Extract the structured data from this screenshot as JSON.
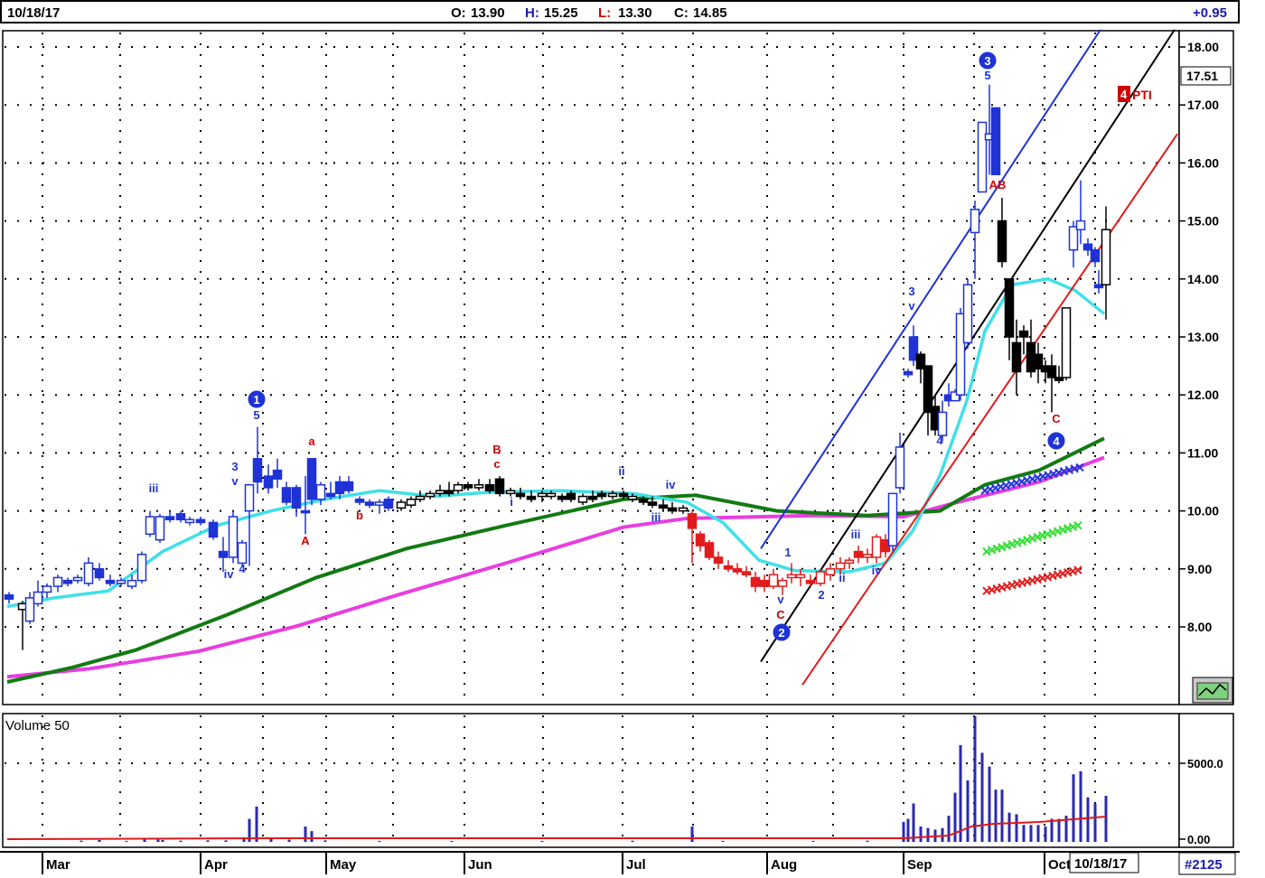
{
  "header": {
    "date": "10/18/17",
    "open_label": "O:",
    "open": "13.90",
    "high_label": "H:",
    "high": "15.25",
    "low_label": "L:",
    "low": "13.30",
    "close_label": "C:",
    "close": "14.85",
    "change": "+0.95"
  },
  "footer": {
    "months": [
      "Mar",
      "Apr",
      "May",
      "Jun",
      "Jul",
      "Aug",
      "Sep",
      "Oct"
    ],
    "date_badge": "10/18/17",
    "record": "#2125"
  },
  "chart_data": [
    {
      "type": "candlestick",
      "price_ticks": [
        "18.00",
        "17.00",
        "16.00",
        "15.00",
        "14.00",
        "13.00",
        "12.00",
        "11.00",
        "10.00",
        "9.00",
        "8.00"
      ],
      "ylim": [
        7.0,
        18.3
      ],
      "last_price_tag": "17.51",
      "target_tag_number": "4",
      "target_tag_text": "PTI",
      "colors": {
        "up_wave": "#1e32d6",
        "down_wave": "#e11c1c",
        "neutral": "#000000",
        "ma_fast": "#3fe0e8",
        "ma_mid": "#127a12",
        "ma_slow": "#e83ee0"
      },
      "wave_counts": [
        {
          "label": "1",
          "circled": true,
          "color": "blue"
        },
        {
          "label": "2",
          "circled": true,
          "color": "blue"
        },
        {
          "label": "3",
          "circled": true,
          "color": "blue"
        },
        {
          "label": "4",
          "circled": true,
          "color": "blue"
        },
        {
          "label": "5",
          "color": "blue"
        },
        {
          "label": "A",
          "color": "red"
        },
        {
          "label": "a",
          "color": "red"
        },
        {
          "label": "b",
          "color": "red"
        },
        {
          "label": "B",
          "color": "red"
        },
        {
          "label": "c",
          "color": "red"
        },
        {
          "label": "C",
          "color": "red"
        },
        {
          "label": "i",
          "color": "blue"
        },
        {
          "label": "ii",
          "color": "blue"
        },
        {
          "label": "iii",
          "color": "blue"
        },
        {
          "label": "iv",
          "color": "blue"
        },
        {
          "label": "v",
          "color": "blue"
        },
        {
          "label": "AB",
          "color": "red"
        }
      ],
      "moving_averages": [
        {
          "name": "fast",
          "color": "cyan"
        },
        {
          "name": "mid",
          "color": "green"
        },
        {
          "name": "slow",
          "color": "magenta"
        }
      ]
    },
    {
      "type": "bar",
      "title": "Volume 50",
      "volume_ticks": [
        "5000.0",
        "0.00"
      ],
      "ylim": [
        0,
        8000
      ]
    }
  ]
}
